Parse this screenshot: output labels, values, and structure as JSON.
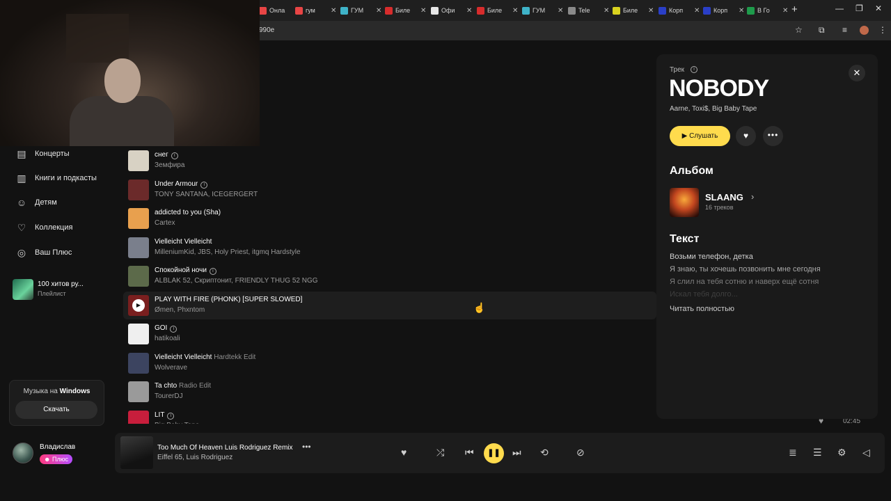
{
  "browser": {
    "tabs": [
      {
        "label": "Онла",
        "color": "#e84545"
      },
      {
        "label": "гум",
        "color": "#e84545"
      },
      {
        "label": "ГУМ",
        "color": "#3fb3c8"
      },
      {
        "label": "Биле",
        "color": "#d72c2c"
      },
      {
        "label": "Офи",
        "color": "#e6e6e6"
      },
      {
        "label": "Биле",
        "color": "#d72c2c"
      },
      {
        "label": "ГУМ",
        "color": "#3fb3c8"
      },
      {
        "label": "Tele",
        "color": "#8a8a8a"
      },
      {
        "label": "Биле",
        "color": "#d9d21f"
      },
      {
        "label": "Корп",
        "color": "#2a3fc7"
      },
      {
        "label": "Корп",
        "color": "#2a3fc7"
      },
      {
        "label": "В Го",
        "color": "#1e9b4b"
      }
    ],
    "url_fragment": "990e"
  },
  "sidebar": {
    "items": [
      {
        "label": "Концерты",
        "icon": "tickets-icon"
      },
      {
        "label": "Книги и подкасты",
        "icon": "book-icon"
      },
      {
        "label": "Детям",
        "icon": "kids-icon"
      },
      {
        "label": "Коллекция",
        "icon": "heart-icon"
      },
      {
        "label": "Ваш Плюс",
        "icon": "plus-icon"
      }
    ],
    "playlist": {
      "title": "100 хитов ру...",
      "subtitle": "Плейлист"
    },
    "promo": {
      "prefix": "Музыка на ",
      "platform": "Windows",
      "button": "Скачать"
    },
    "user": {
      "name": "Владислав",
      "badge": "Плюс"
    }
  },
  "tracks": [
    {
      "title": "снег",
      "version": "",
      "explicit": true,
      "artist": "Земфира",
      "cover": "#d8d2c4"
    },
    {
      "title": "Under Armour",
      "version": "",
      "explicit": true,
      "artist": "TONY SANTANA, ICEGERGERT",
      "cover": "#6b2a2a"
    },
    {
      "title": "addicted to you (Sha)",
      "version": "",
      "explicit": false,
      "artist": "Cartex",
      "cover": "#e8a04e"
    },
    {
      "title": "Vielleicht Vielleicht",
      "version": "",
      "explicit": false,
      "artist": "MilleniumKid, JBS, Holy Priest, itgmq Hardstyle",
      "cover": "#7a7f8c"
    },
    {
      "title": "Спокойной ночи",
      "version": "",
      "explicit": true,
      "artist": "ALBLAK 52, Скриптонит, FRIENDLY THUG 52 NGG",
      "cover": "#5c6a4a"
    },
    {
      "title": "PLAY WITH FIRE (PHONK) [SUPER SLOWED]",
      "version": "",
      "explicit": false,
      "artist": "Ømen, Phxntom",
      "cover": "#7a1f1f",
      "active": true
    },
    {
      "title": "GOI",
      "version": "",
      "explicit": true,
      "artist": "hatikoali",
      "cover": "#efefef"
    },
    {
      "title": "Vielleicht Vielleicht",
      "version": "Hardtekk Edit",
      "explicit": false,
      "artist": "Wolverave",
      "cover": "#3c4460"
    },
    {
      "title": "Ta chto",
      "version": "Radio Edit",
      "explicit": false,
      "artist": "TourerDJ",
      "cover": "#9a9a9a"
    },
    {
      "title": "LIT",
      "version": "",
      "explicit": true,
      "artist": "Big Baby Tape",
      "cover": "#c81e3c"
    }
  ],
  "bottom_row": {
    "duration": "02:45"
  },
  "panel": {
    "label": "Трек",
    "title": "NOBODY",
    "artists": "Aarne, Toxi$, Big Baby Tape",
    "listen": "Слушать",
    "album_heading": "Альбом",
    "album_name": "SLAANG",
    "album_count": "16 треков",
    "lyrics_heading": "Текст",
    "lyrics": [
      "Возьми телефон, детка",
      "Я знаю, ты хочешь позвонить мне сегодня",
      "Я слил на тебя сотню и наверх ещё сотня",
      "Искал тебя долго..."
    ],
    "read_full": "Читать полностью"
  },
  "player": {
    "title": "Too Much Of Heaven Luis Rodriguez Remix",
    "artist": "Eiffel 65, Luis Rodriguez",
    "accent": "#ffdb4d"
  }
}
